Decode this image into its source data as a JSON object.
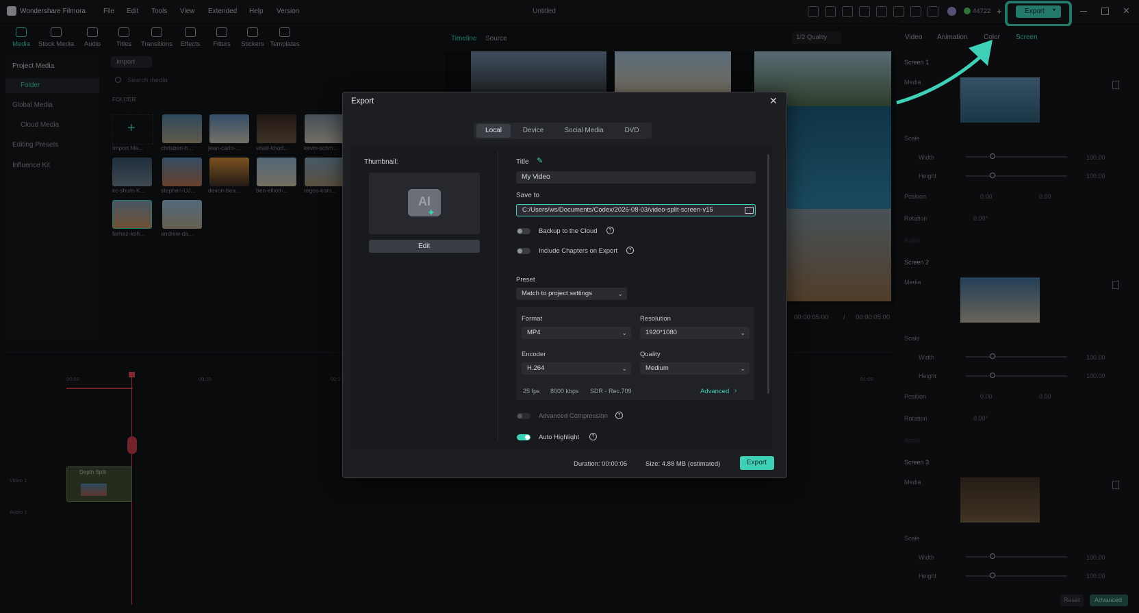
{
  "app": {
    "name": "Wondershare Filmora",
    "menu": [
      "File",
      "Edit",
      "Tools",
      "View",
      "Extended",
      "Help",
      "Version"
    ],
    "project_title": "Untitled",
    "credits": "44722",
    "export_button": "Export"
  },
  "toolbar": {
    "tabs": [
      "Media",
      "Stock Media",
      "Audio",
      "Titles",
      "Transitions",
      "Effects",
      "Filters",
      "Stickers",
      "Templates"
    ]
  },
  "media_panel": {
    "sidebar": [
      "Project Media",
      "Folder",
      "Global Media",
      "Cloud Media",
      "Editing Presets",
      "Influence Kit"
    ],
    "import_label": "Import",
    "search_placeholder": "Search media",
    "folder_header": "FOLDER",
    "items": [
      "Import Me...",
      "chrisban-h...",
      "jean-carlo-...",
      "vitalii-khod...",
      "kevin-schm...",
      "kc-shum-K...",
      "stephen-UJ...",
      "devon-bea...",
      "ben-elliott-...",
      "regos-kom...",
      "farnaz-koh...",
      "andrew-da..."
    ]
  },
  "preview": {
    "tabs": [
      "Timeline",
      "Source"
    ],
    "quality": "1/2 Quality",
    "time_current": "00:00:05:00",
    "time_total": "00:00:05:00"
  },
  "timeline": {
    "clip_label": "Depth Split",
    "track_video": "Video 1",
    "track_audio": "Audio 1",
    "ruler": [
      "00:00",
      "00:10",
      "00:2",
      "01:00"
    ]
  },
  "inspector": {
    "tabs": [
      "Video",
      "Animation",
      "Color",
      "Screen"
    ],
    "screens": [
      "Screen 1",
      "Screen 2",
      "Screen 3"
    ],
    "media_label": "Media",
    "scale_label": "Scale",
    "width_label": "Width",
    "height_label": "Height",
    "position_label": "Position",
    "rotation_label": "Rotation",
    "audio_label": "Audio",
    "scale_value": "100.00",
    "pos_value": "0.00",
    "rotation_value": "0.00°",
    "reset_button": "Reset",
    "advanced_button": "Advanced"
  },
  "export_dialog": {
    "title": "Export",
    "tabs": [
      "Local",
      "Device",
      "Social Media",
      "DVD"
    ],
    "thumbnail_label": "Thumbnail:",
    "edit_button": "Edit",
    "title_label": "Title",
    "title_value": "My Video",
    "save_to_label": "Save to",
    "save_path": "C:/Users/ws/Documents/Codex/2026-08-03/video-split-screen-v15",
    "backup_label": "Backup to the Cloud",
    "chapters_label": "Include Chapters on Export",
    "preset_label": "Preset",
    "preset_value": "Match to project settings",
    "format_label": "Format",
    "format_value": "MP4",
    "resolution_label": "Resolution",
    "resolution_value": "1920*1080",
    "encoder_label": "Encoder",
    "encoder_value": "H.264",
    "quality_label": "Quality",
    "quality_value": "Medium",
    "fps": "25 fps",
    "bitrate": "8000 kbps",
    "color_space": "SDR - Rec.709",
    "advanced_link": "Advanced",
    "advanced_compression_label": "Advanced Compression",
    "auto_highlight_label": "Auto Highlight",
    "duration": "Duration: 00:00:05",
    "size": "Size:  4.88 MB (estimated)",
    "export_button": "Export"
  },
  "colors": {
    "accent": "#3fd1b8",
    "background": "#121316",
    "dialog": "#1d1e22"
  }
}
